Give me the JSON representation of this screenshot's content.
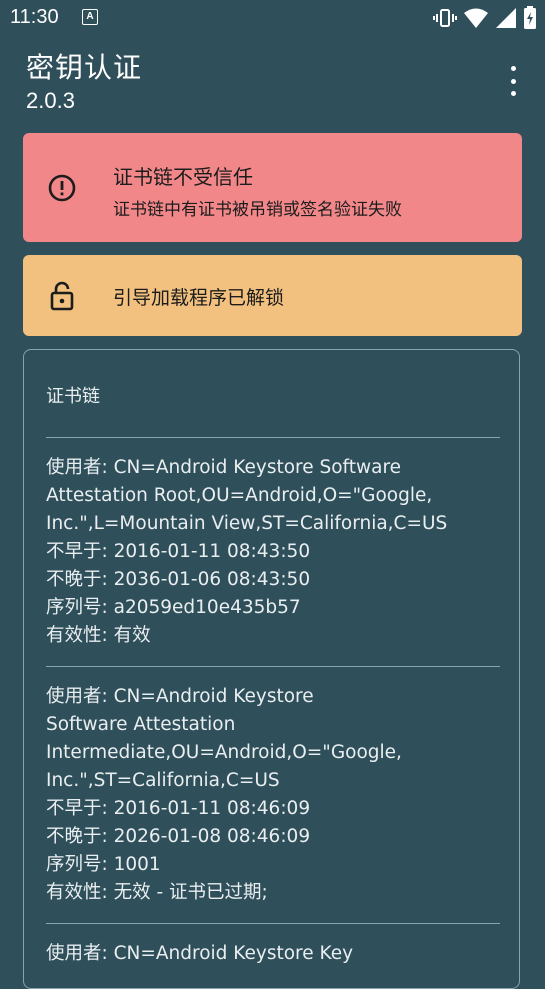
{
  "status_bar": {
    "time": "11:30",
    "notification_badge": "A",
    "icons": [
      "vibrate-icon",
      "wifi-icon",
      "signal-icon",
      "battery-icon"
    ]
  },
  "app_bar": {
    "title": "密钥认证",
    "version": "2.0.3"
  },
  "error_card": {
    "title": "证书链不受信任",
    "subtitle": "证书链中有证书被吊销或签名验证失败",
    "color": "#f2878a"
  },
  "bootloader_card": {
    "title": "引导加载程序已解锁",
    "color": "#f2c17f"
  },
  "chain_card": {
    "heading": "证书链",
    "certs": [
      {
        "subject_lines": [
          "使用者: CN=Android Keystore Software",
          "Attestation Root,OU=Android,O=\"Google,",
          "Inc.\",L=Mountain View,ST=California,C=US"
        ],
        "not_before": "不早于: 2016-01-11 08:43:50",
        "not_after": "不晚于: 2036-01-06 08:43:50",
        "serial": "序列号: a2059ed10e435b57",
        "validity": "有效性: 有效"
      },
      {
        "subject_lines": [
          "使用者: CN=Android Keystore",
          "Software Attestation",
          "Intermediate,OU=Android,O=\"Google,",
          "Inc.\",ST=California,C=US"
        ],
        "not_before": "不早于: 2016-01-11 08:46:09",
        "not_after": "不晚于: 2026-01-08 08:46:09",
        "serial": "序列号: 1001",
        "validity": "有效性: 无效 - 证书已过期;"
      },
      {
        "subject_lines": [
          "使用者: CN=Android Keystore Key"
        ]
      }
    ]
  }
}
